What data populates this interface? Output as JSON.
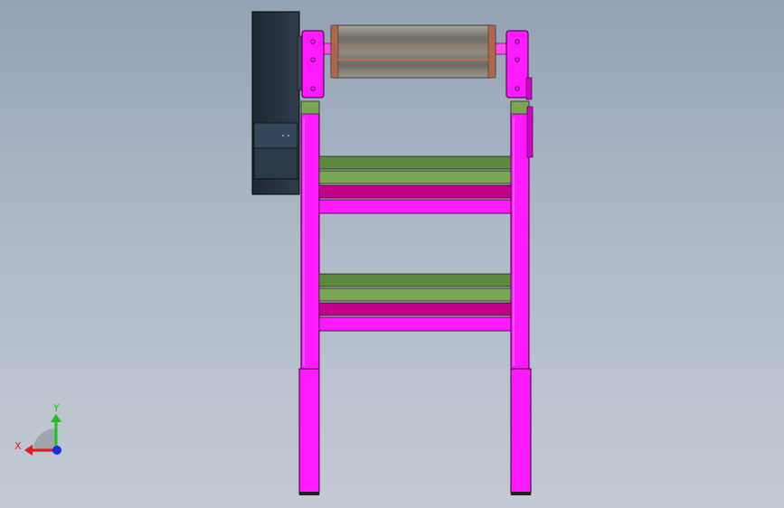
{
  "triad": {
    "x_label": "X",
    "y_label": "Y"
  },
  "colors": {
    "frame_magenta": "#ff1aff",
    "frame_magenta_dark": "#d200c8",
    "crossbar_green": "#5d8a3e",
    "crossbar_green_light": "#79a655",
    "crossbar_purple": "#c2008a",
    "motor_dark": "#26323f",
    "roller_metal": "#8e8a80",
    "roller_copper": "#b0664a",
    "axis_x": "#e21b1b",
    "axis_y": "#1cc21c",
    "axis_z": "#1b2be0"
  },
  "icons": {
    "triad": "coordinate-triad-icon"
  }
}
